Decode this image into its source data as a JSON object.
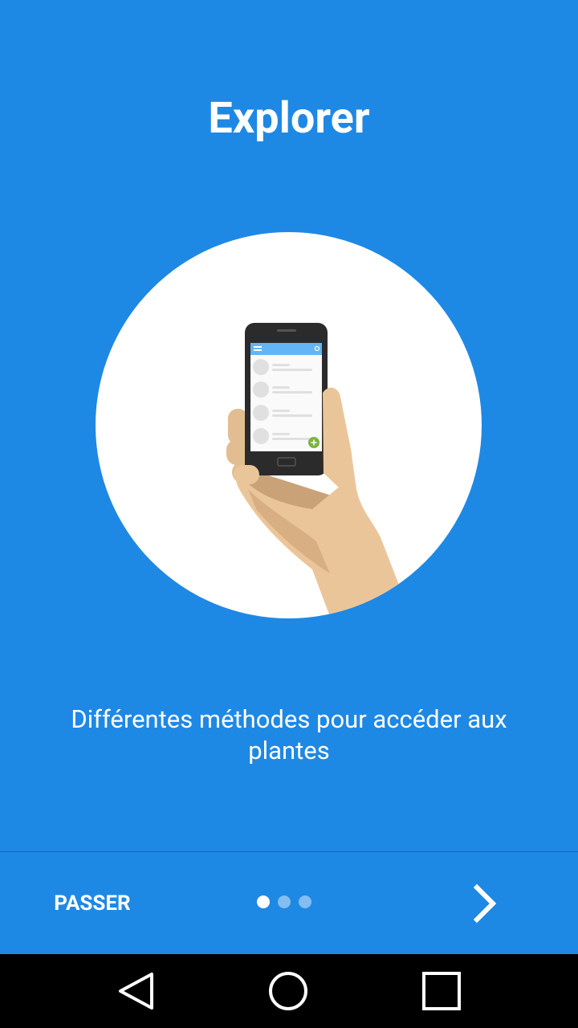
{
  "onboarding": {
    "title": "Explorer",
    "description": "Différentes méthodes pour accéder aux plantes",
    "illustration_icon": "hand-holding-phone-icon"
  },
  "footer": {
    "skip_label": "PASSER",
    "next_icon": "chevron-right-icon",
    "page_indicator": {
      "total": 3,
      "current": 1
    }
  },
  "system_nav": {
    "back_icon": "back-triangle-icon",
    "home_icon": "home-circle-icon",
    "recents_icon": "recents-square-icon"
  },
  "colors": {
    "background": "#1E88E5",
    "accent_green": "#7CB342"
  }
}
